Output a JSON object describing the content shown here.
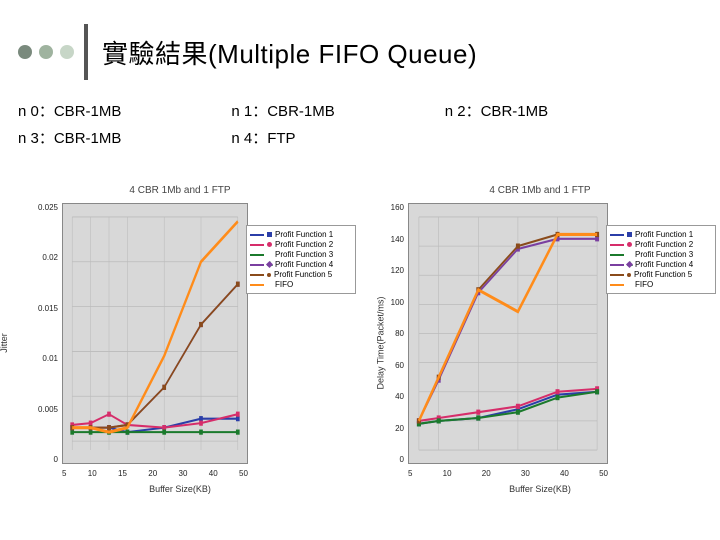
{
  "title": "實驗結果(Multiple FIFO Queue)",
  "scenarios": {
    "n0": "n 0：CBR-1MB",
    "n1": "n 1：CBR-1MB",
    "n2": "n 2：CBR-1MB",
    "n3": "n 3：CBR-1MB",
    "n4": "n 4：FTP"
  },
  "legend_entries": {
    "s1": "Profit Function 1",
    "s2": "Profit Function 2",
    "s3": "Profit Function 3",
    "s4": "Profit Function 4",
    "s5": "Profit Function 5",
    "s6": "FIFO"
  },
  "chart_data": [
    {
      "type": "line",
      "title": "4 CBR 1Mb and 1 FTP",
      "xlabel": "Buffer Size(KB)",
      "ylabel": "Jitter",
      "x": [
        5,
        10,
        15,
        20,
        30,
        40,
        50
      ],
      "xlim": [
        5,
        50
      ],
      "ylim": [
        -0.001,
        0.025
      ],
      "yticks": [
        0.025,
        0.02,
        0.015,
        0.01,
        0.005,
        0
      ],
      "series": [
        {
          "name": "Profit Function 1",
          "values": [
            0.0015,
            0.0015,
            0.0015,
            0.001,
            0.0015,
            0.0025,
            0.0025
          ]
        },
        {
          "name": "Profit Function 2",
          "values": [
            0.0018,
            0.002,
            0.003,
            0.0018,
            0.0015,
            0.002,
            0.003
          ]
        },
        {
          "name": "Profit Function 3",
          "values": [
            0.001,
            0.001,
            0.001,
            0.001,
            0.001,
            0.001,
            0.001
          ]
        },
        {
          "name": "Profit Function 4",
          "values": [
            0.0015,
            0.0015,
            0.0015,
            0.0018,
            0.006,
            0.013,
            0.0175
          ]
        },
        {
          "name": "Profit Function 5",
          "values": [
            0.0015,
            0.0015,
            0.0015,
            0.0018,
            0.006,
            0.013,
            0.0175
          ]
        },
        {
          "name": "FIFO",
          "values": [
            0.0015,
            0.0015,
            0.001,
            0.0015,
            0.0095,
            0.02,
            0.0245
          ]
        }
      ]
    },
    {
      "type": "line",
      "title": "4 CBR 1Mb and 1 FTP",
      "xlabel": "Buffer Size(KB)",
      "ylabel": "Delay Time(Packet/ms)",
      "x": [
        5,
        10,
        20,
        30,
        40,
        50
      ],
      "xlim": [
        5,
        50
      ],
      "ylim": [
        0,
        160
      ],
      "yticks": [
        160,
        140,
        120,
        100,
        80,
        60,
        40,
        20,
        0
      ],
      "series": [
        {
          "name": "Profit Function 1",
          "values": [
            18,
            20,
            22,
            28,
            38,
            40
          ]
        },
        {
          "name": "Profit Function 2",
          "values": [
            20,
            22,
            26,
            30,
            40,
            42
          ]
        },
        {
          "name": "Profit Function 3",
          "values": [
            18,
            20,
            22,
            26,
            36,
            40
          ]
        },
        {
          "name": "Profit Function 4",
          "values": [
            20,
            48,
            108,
            138,
            145,
            145
          ]
        },
        {
          "name": "Profit Function 5",
          "values": [
            20,
            50,
            110,
            140,
            148,
            148
          ]
        },
        {
          "name": "FIFO",
          "values": [
            20,
            50,
            110,
            95,
            148,
            148
          ]
        }
      ]
    }
  ]
}
